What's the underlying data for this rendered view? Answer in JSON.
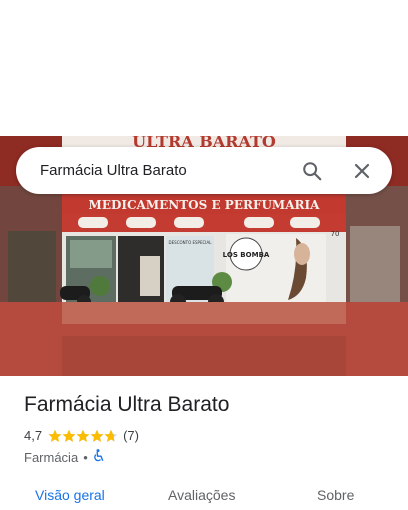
{
  "search": {
    "query": "Farmácia Ultra Barato"
  },
  "photo": {
    "facade_sign": "ULTRA BARATO",
    "banner_text": "MEDICAMENTOS E PERFUMARIA",
    "poster_text": "LOS BOMBA",
    "door_sign": "DESCONTO ESPECIAL",
    "store_number": "70"
  },
  "place": {
    "name": "Farmácia Ultra Barato",
    "rating": "4,7",
    "rating_fraction": 0.94,
    "review_count": "(7)",
    "category": "Farmácia",
    "separator": "•"
  },
  "tabs": [
    {
      "label": "Visão geral",
      "active": true
    },
    {
      "label": "Avaliações",
      "active": false
    },
    {
      "label": "Sobre",
      "active": false
    }
  ],
  "colors": {
    "accent": "#1a73e8",
    "star": "#fbbc04",
    "wall_red": "#a8322a"
  },
  "icons": {
    "search": "search-icon",
    "close": "close-icon",
    "accessibility": "wheelchair-icon"
  }
}
